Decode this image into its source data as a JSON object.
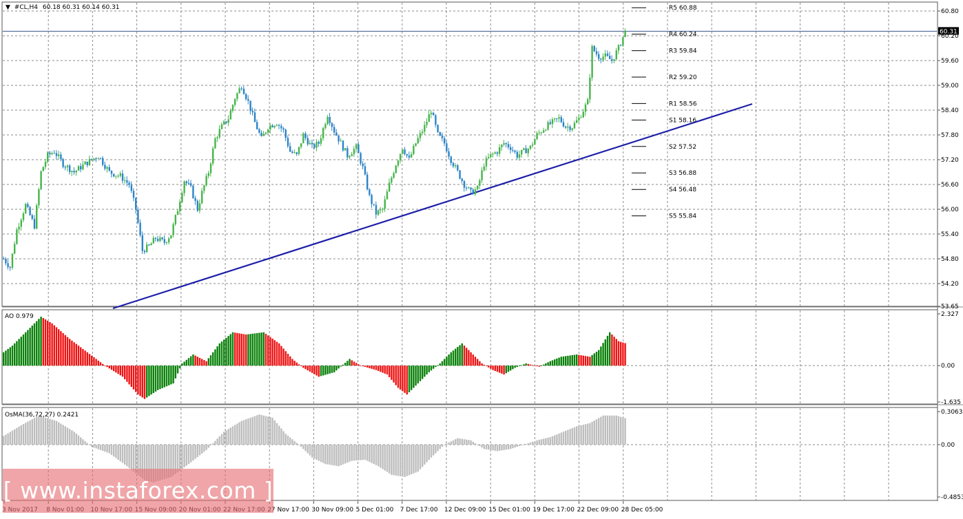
{
  "header": {
    "symbol": "#CL,H4",
    "ohlc": "60.18 60.31 60.14 60.31"
  },
  "chart_data": [
    {
      "type": "candlestick",
      "title": "#CL,H4 60.18 60.31 60.14 60.31",
      "ylim": [
        53.65,
        61.0
      ],
      "y_ticks": [
        "60.80",
        "60.20",
        "59.60",
        "59.00",
        "58.40",
        "57.80",
        "57.20",
        "56.60",
        "56.00",
        "55.40",
        "54.80",
        "54.20",
        "53.65"
      ],
      "y_ticks_num": [
        60.8,
        60.2,
        59.6,
        59.0,
        58.4,
        57.8,
        57.2,
        56.6,
        56.0,
        55.4,
        54.8,
        54.2,
        53.65
      ],
      "current_price": "60.31",
      "current_price_num": 60.31,
      "x_labels": [
        "3 Nov 2017",
        "8 Nov 01:00",
        "10 Nov 17:00",
        "15 Nov 09:00",
        "20 Nov 01:00",
        "22 Nov 17:00",
        "27 Nov 17:00",
        "30 Nov 09:00",
        "5 Dec 01:00",
        "7 Dec 17:00",
        "12 Dec 09:00",
        "15 Dec 01:00",
        "19 Dec 17:00",
        "22 Dec 09:00",
        "28 Dec 05:00"
      ],
      "close_path": [
        [
          0,
          54.8
        ],
        [
          3,
          54.6
        ],
        [
          6,
          55.5
        ],
        [
          10,
          56.1
        ],
        [
          14,
          55.6
        ],
        [
          17,
          56.9
        ],
        [
          20,
          57.3
        ],
        [
          23,
          57.4
        ],
        [
          27,
          57.1
        ],
        [
          32,
          56.9
        ],
        [
          37,
          57.1
        ],
        [
          43,
          57.3
        ],
        [
          48,
          56.9
        ],
        [
          53,
          56.8
        ],
        [
          57,
          56.6
        ],
        [
          60,
          56.0
        ],
        [
          63,
          55.0
        ],
        [
          66,
          55.1
        ],
        [
          69,
          55.3
        ],
        [
          73,
          55.2
        ],
        [
          76,
          55.4
        ],
        [
          79,
          56.0
        ],
        [
          82,
          56.7
        ],
        [
          85,
          56.5
        ],
        [
          88,
          56.0
        ],
        [
          90,
          56.4
        ],
        [
          93,
          56.9
        ],
        [
          96,
          57.7
        ],
        [
          99,
          58.0
        ],
        [
          102,
          58.2
        ],
        [
          105,
          58.7
        ],
        [
          108,
          59.0
        ],
        [
          111,
          58.6
        ],
        [
          114,
          58.1
        ],
        [
          117,
          57.7
        ],
        [
          120,
          58.0
        ],
        [
          124,
          58.1
        ],
        [
          127,
          57.9
        ],
        [
          130,
          57.4
        ],
        [
          133,
          57.3
        ],
        [
          136,
          57.8
        ],
        [
          140,
          57.5
        ],
        [
          143,
          57.6
        ],
        [
          147,
          58.3
        ],
        [
          150,
          57.9
        ],
        [
          153,
          57.6
        ],
        [
          156,
          57.3
        ],
        [
          160,
          57.5
        ],
        [
          163,
          57.0
        ],
        [
          166,
          56.3
        ],
        [
          169,
          55.9
        ],
        [
          172,
          56.0
        ],
        [
          175,
          56.6
        ],
        [
          178,
          57.1
        ],
        [
          181,
          57.5
        ],
        [
          184,
          57.2
        ],
        [
          187,
          57.6
        ],
        [
          191,
          58.0
        ],
        [
          194,
          58.4
        ],
        [
          197,
          57.8
        ],
        [
          200,
          57.6
        ],
        [
          203,
          57.2
        ],
        [
          206,
          56.9
        ],
        [
          209,
          56.6
        ],
        [
          212,
          56.4
        ],
        [
          215,
          56.5
        ],
        [
          218,
          57.1
        ],
        [
          221,
          57.3
        ],
        [
          224,
          57.4
        ],
        [
          227,
          57.6
        ],
        [
          230,
          57.5
        ],
        [
          233,
          57.3
        ],
        [
          236,
          57.4
        ],
        [
          239,
          57.5
        ],
        [
          242,
          57.8
        ],
        [
          246,
          58.0
        ],
        [
          249,
          58.1
        ],
        [
          252,
          58.2
        ],
        [
          255,
          58.0
        ],
        [
          258,
          58.0
        ],
        [
          261,
          58.2
        ],
        [
          265,
          58.6
        ],
        [
          267,
          59.9
        ],
        [
          270,
          59.7
        ],
        [
          273,
          59.7
        ],
        [
          276,
          59.6
        ],
        [
          279,
          59.9
        ],
        [
          282,
          60.3
        ]
      ],
      "candle_count": 283,
      "pivots": [
        {
          "label": "R5",
          "value": "60.88",
          "num": 60.88
        },
        {
          "label": "R4",
          "value": "60.24",
          "num": 60.24
        },
        {
          "label": "R3",
          "value": "59.84",
          "num": 59.84
        },
        {
          "label": "R2",
          "value": "59.20",
          "num": 59.2
        },
        {
          "label": "R1",
          "value": "58.56",
          "num": 58.56
        },
        {
          "label": "S1",
          "value": "58.16",
          "num": 58.16
        },
        {
          "label": "S2",
          "value": "57.52",
          "num": 57.52
        },
        {
          "label": "S3",
          "value": "56.88",
          "num": 56.88
        },
        {
          "label": "S4",
          "value": "56.48",
          "num": 56.48
        },
        {
          "label": "S5",
          "value": "55.84",
          "num": 55.84
        }
      ],
      "trendline": {
        "from": [
          50,
          53.6
        ],
        "to": [
          340,
          58.55
        ]
      },
      "colors": {
        "bull": "#45b44a",
        "bear": "#2a83c6",
        "trend": "#1c1fa8",
        "grid": "#8a8a8a"
      }
    },
    {
      "type": "bar",
      "title": "AO 0.979",
      "ylim": [
        -1.635,
        2.327
      ],
      "y_ticks": [
        "2.327",
        "0.00",
        "-1.635"
      ],
      "y_ticks_num": [
        2.327,
        0.0,
        -1.635
      ],
      "curve": [
        [
          0,
          0.6
        ],
        [
          4,
          0.9
        ],
        [
          12,
          1.7
        ],
        [
          17,
          2.2
        ],
        [
          22,
          1.9
        ],
        [
          30,
          1.2
        ],
        [
          38,
          0.6
        ],
        [
          46,
          0.0
        ],
        [
          54,
          -0.5
        ],
        [
          61,
          -1.3
        ],
        [
          64,
          -1.5
        ],
        [
          70,
          -1.1
        ],
        [
          77,
          -0.8
        ],
        [
          81,
          0.1
        ],
        [
          86,
          0.5
        ],
        [
          92,
          0.2
        ],
        [
          98,
          1.0
        ],
        [
          104,
          1.5
        ],
        [
          110,
          1.4
        ],
        [
          118,
          1.5
        ],
        [
          125,
          1.0
        ],
        [
          131,
          0.3
        ],
        [
          136,
          -0.1
        ],
        [
          143,
          -0.5
        ],
        [
          150,
          -0.3
        ],
        [
          157,
          0.3
        ],
        [
          162,
          0.0
        ],
        [
          169,
          -0.2
        ],
        [
          174,
          -0.4
        ],
        [
          179,
          -1.0
        ],
        [
          183,
          -1.3
        ],
        [
          188,
          -0.8
        ],
        [
          193,
          -0.3
        ],
        [
          198,
          0.1
        ],
        [
          203,
          0.6
        ],
        [
          208,
          1.0
        ],
        [
          212,
          0.6
        ],
        [
          217,
          0.1
        ],
        [
          222,
          -0.2
        ],
        [
          227,
          -0.4
        ],
        [
          232,
          -0.1
        ],
        [
          237,
          0.1
        ],
        [
          243,
          -0.05
        ],
        [
          248,
          0.2
        ],
        [
          253,
          0.4
        ],
        [
          260,
          0.5
        ],
        [
          266,
          0.4
        ],
        [
          270,
          0.7
        ],
        [
          275,
          1.5
        ],
        [
          279,
          1.1
        ],
        [
          283,
          0.98
        ]
      ],
      "colors": {
        "up": "#078007",
        "down": "#ee1111"
      }
    },
    {
      "type": "bar",
      "title": "OsMA(36,72,27) 0.2421",
      "ylim": [
        -0.4853,
        0.3063
      ],
      "y_ticks": [
        "0.3063",
        "0.00",
        "-0.4853"
      ],
      "y_ticks_num": [
        0.3063,
        0.0,
        -0.4853
      ],
      "curve": [
        [
          0,
          0.08
        ],
        [
          8,
          0.18
        ],
        [
          16,
          0.27
        ],
        [
          24,
          0.22
        ],
        [
          32,
          0.12
        ],
        [
          40,
          -0.02
        ],
        [
          48,
          -0.08
        ],
        [
          56,
          -0.2
        ],
        [
          64,
          -0.33
        ],
        [
          68,
          -0.35
        ],
        [
          76,
          -0.3
        ],
        [
          84,
          -0.18
        ],
        [
          92,
          -0.05
        ],
        [
          100,
          0.12
        ],
        [
          108,
          0.22
        ],
        [
          116,
          0.28
        ],
        [
          122,
          0.25
        ],
        [
          128,
          0.1
        ],
        [
          134,
          0.0
        ],
        [
          140,
          -0.12
        ],
        [
          146,
          -0.18
        ],
        [
          152,
          -0.2
        ],
        [
          158,
          -0.15
        ],
        [
          164,
          -0.14
        ],
        [
          170,
          -0.2
        ],
        [
          176,
          -0.28
        ],
        [
          182,
          -0.3
        ],
        [
          188,
          -0.25
        ],
        [
          194,
          -0.12
        ],
        [
          200,
          0.0
        ],
        [
          206,
          0.06
        ],
        [
          212,
          0.04
        ],
        [
          218,
          -0.04
        ],
        [
          224,
          -0.06
        ],
        [
          230,
          -0.04
        ],
        [
          236,
          0.0
        ],
        [
          242,
          0.04
        ],
        [
          248,
          0.07
        ],
        [
          254,
          0.12
        ],
        [
          260,
          0.17
        ],
        [
          266,
          0.2
        ],
        [
          272,
          0.27
        ],
        [
          278,
          0.27
        ],
        [
          283,
          0.24
        ]
      ],
      "color": "#bdbdbd"
    }
  ],
  "watermark": {
    "text": "[ www.instaforex.com ]"
  }
}
